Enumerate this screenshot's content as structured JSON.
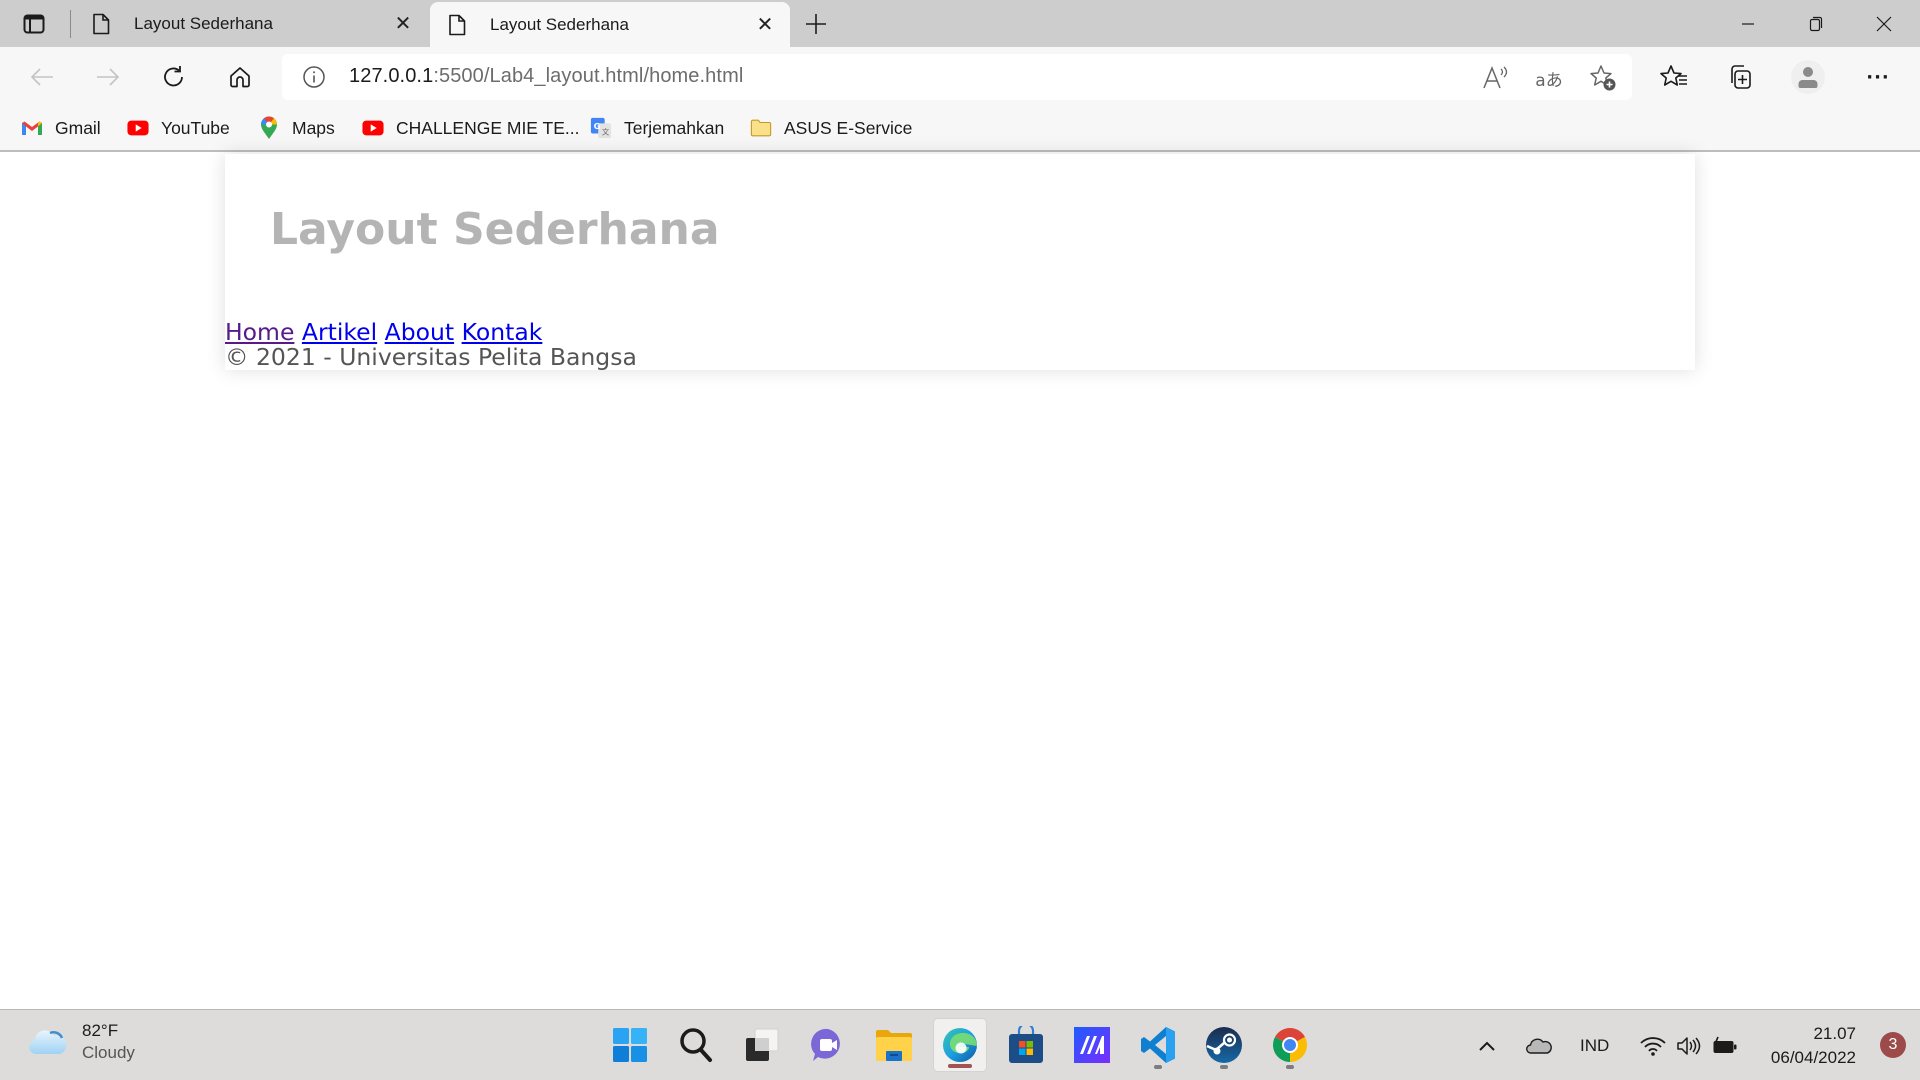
{
  "browser": {
    "tabs": [
      {
        "title": "Layout Sederhana",
        "active": false
      },
      {
        "title": "Layout Sederhana",
        "active": true
      }
    ],
    "tab_close_glyph": "✕",
    "new_tab_glyph": "+",
    "url_host": "127.0.0.1",
    "url_rest": ":5500/Lab4_layout.html/home.html",
    "icons": {
      "tab_actions": "tab-actions-icon",
      "back": "back-arrow-icon",
      "forward": "forward-arrow-icon",
      "refresh": "refresh-icon",
      "home": "home-icon",
      "site_info": "info-icon",
      "read_aloud": "read-aloud-icon",
      "translate": "translate-icon",
      "add_favorite": "add-favorite-icon",
      "favorites": "favorites-icon",
      "collections": "collections-icon",
      "profile": "profile-icon",
      "more": "more-icon"
    },
    "read_aloud_glyph": "A",
    "translate_glyph": "aあ",
    "more_glyph": "···",
    "bookmarks": [
      {
        "label": "Gmail",
        "icon": "gmail-icon"
      },
      {
        "label": "YouTube",
        "icon": "youtube-icon"
      },
      {
        "label": "Maps",
        "icon": "maps-icon"
      },
      {
        "label": "CHALLENGE MIE TE...",
        "icon": "youtube-icon"
      },
      {
        "label": "Terjemahkan",
        "icon": "google-translate-icon"
      },
      {
        "label": "ASUS E-Service",
        "icon": "folder-icon"
      }
    ]
  },
  "page": {
    "header_title": "Layout Sederhana",
    "nav": [
      {
        "label": "Home",
        "visited": true
      },
      {
        "label": "Artikel",
        "visited": false
      },
      {
        "label": "About",
        "visited": false
      },
      {
        "label": "Kontak",
        "visited": false
      }
    ],
    "footer": "© 2021 - Universitas Pelita Bangsa",
    "colors": {
      "heading": "#b4b4b4",
      "link": "#0000ee",
      "visited_link": "#551a8b",
      "footer_text": "#555555"
    }
  },
  "taskbar": {
    "weather": {
      "temp": "82°F",
      "condition": "Cloudy"
    },
    "apps": [
      {
        "name": "start",
        "icon": "windows-start-icon",
        "running": false,
        "active": false
      },
      {
        "name": "search",
        "icon": "search-icon",
        "running": false,
        "active": false
      },
      {
        "name": "task-view",
        "icon": "task-view-icon",
        "running": false,
        "active": false
      },
      {
        "name": "chat",
        "icon": "teams-chat-icon",
        "running": false,
        "active": false
      },
      {
        "name": "file-explorer",
        "icon": "file-explorer-icon",
        "running": false,
        "active": false
      },
      {
        "name": "edge",
        "icon": "edge-icon",
        "running": true,
        "active": true
      },
      {
        "name": "microsoft-store",
        "icon": "store-icon",
        "running": false,
        "active": false
      },
      {
        "name": "myasus",
        "icon": "myasus-icon",
        "running": false,
        "active": false
      },
      {
        "name": "vscode",
        "icon": "vscode-icon",
        "running": true,
        "active": false
      },
      {
        "name": "steam",
        "icon": "steam-icon",
        "running": true,
        "active": false
      },
      {
        "name": "chrome",
        "icon": "chrome-icon",
        "running": true,
        "active": false
      }
    ],
    "tray": {
      "language": "IND",
      "time": "21.07",
      "date": "06/04/2022",
      "notification_count": "3"
    }
  }
}
